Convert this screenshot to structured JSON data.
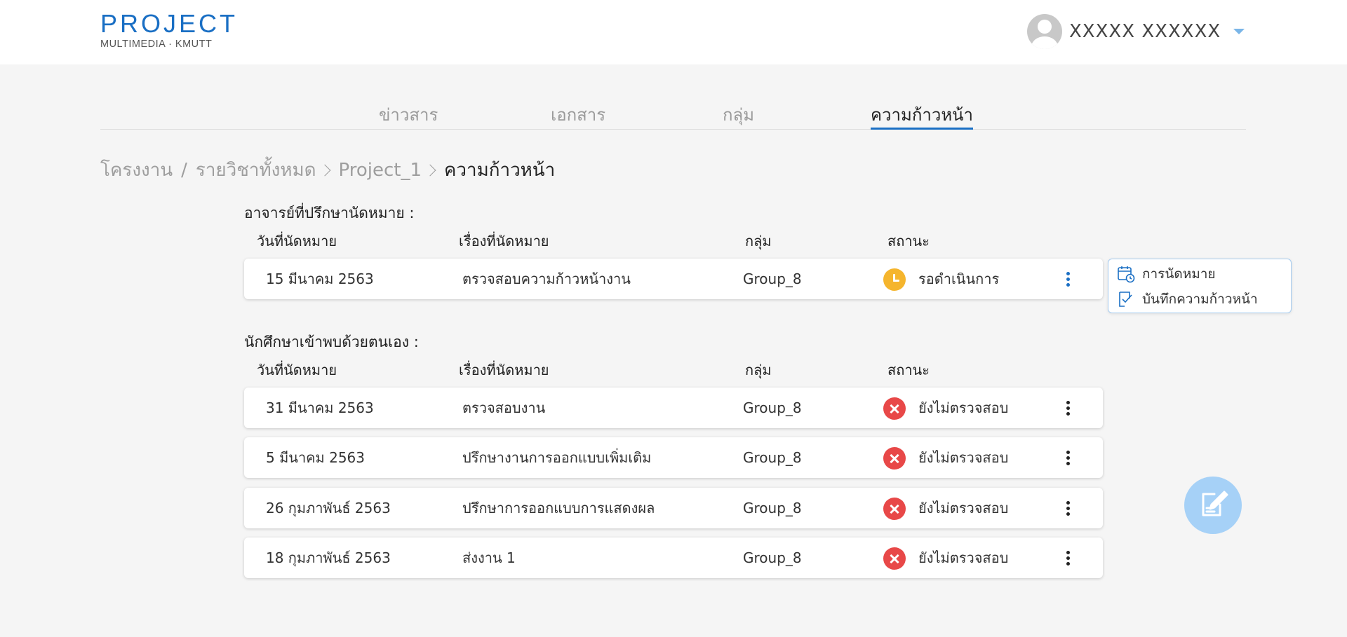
{
  "logo": {
    "title": "PROJECT",
    "subtitle": "MULTIMEDIA · KMUTT"
  },
  "user": {
    "name": "XXXXX XXXXXX"
  },
  "tabs": [
    {
      "label": "ข่าวสาร"
    },
    {
      "label": "เอกสาร"
    },
    {
      "label": "กลุ่ม"
    },
    {
      "label": "ความก้าวหน้า"
    }
  ],
  "breadcrumb": {
    "root": "โครงงาน",
    "slash": "/",
    "all": "รายวิชาทั้งหมด",
    "project": "Project_1",
    "current": "ความก้าวหน้า"
  },
  "advisor_section": {
    "title": "อาจารย์ที่ปรึกษานัดหมาย :",
    "headers": {
      "date": "วันที่นัดหมาย",
      "topic": "เรื่องที่นัดหมาย",
      "group": "กลุ่ม",
      "status": "สถานะ"
    },
    "rows": [
      {
        "date": "15 มีนาคม 2563",
        "topic": "ตรวจสอบความก้าวหน้างาน",
        "group": "Group_8",
        "status": "รอดำเนินการ",
        "status_color": "#f5b52d"
      }
    ]
  },
  "student_section": {
    "title": "นักศึกษาเข้าพบด้วยตนเอง :",
    "headers": {
      "date": "วันที่นัดหมาย",
      "topic": "เรื่องที่นัดหมาย",
      "group": "กลุ่ม",
      "status": "สถานะ"
    },
    "rows": [
      {
        "date": "31 มีนาคม 2563",
        "topic": "ตรวจสอบงาน",
        "group": "Group_8",
        "status": "ยังไม่ตรวจสอบ",
        "status_color": "#e84848"
      },
      {
        "date": "5 มีนาคม 2563",
        "topic": "ปรึกษางานการออกแบบเพิ่มเติม",
        "group": "Group_8",
        "status": "ยังไม่ตรวจสอบ",
        "status_color": "#e84848"
      },
      {
        "date": "26 กุมภาพันธ์ 2563",
        "topic": "ปรึกษาการออกแบบการแสดงผล",
        "group": "Group_8",
        "status": "ยังไม่ตรวจสอบ",
        "status_color": "#e84848"
      },
      {
        "date": "18 กุมภาพันธ์ 2563",
        "topic": "ส่งงาน 1",
        "group": "Group_8",
        "status": "ยังไม่ตรวจสอบ",
        "status_color": "#e84848"
      }
    ]
  },
  "popup_menu": {
    "items": [
      {
        "label": "การนัดหมาย",
        "icon": "calendar-clock-icon"
      },
      {
        "label": "บันทึกความก้าวหน้า",
        "icon": "checklist-icon"
      }
    ]
  },
  "fab": {
    "icon": "edit-note-icon"
  },
  "colors": {
    "accent": "#1a6fc4",
    "pending": "#f5b52d",
    "unchecked": "#e84848",
    "fab": "#a6d1f7"
  }
}
